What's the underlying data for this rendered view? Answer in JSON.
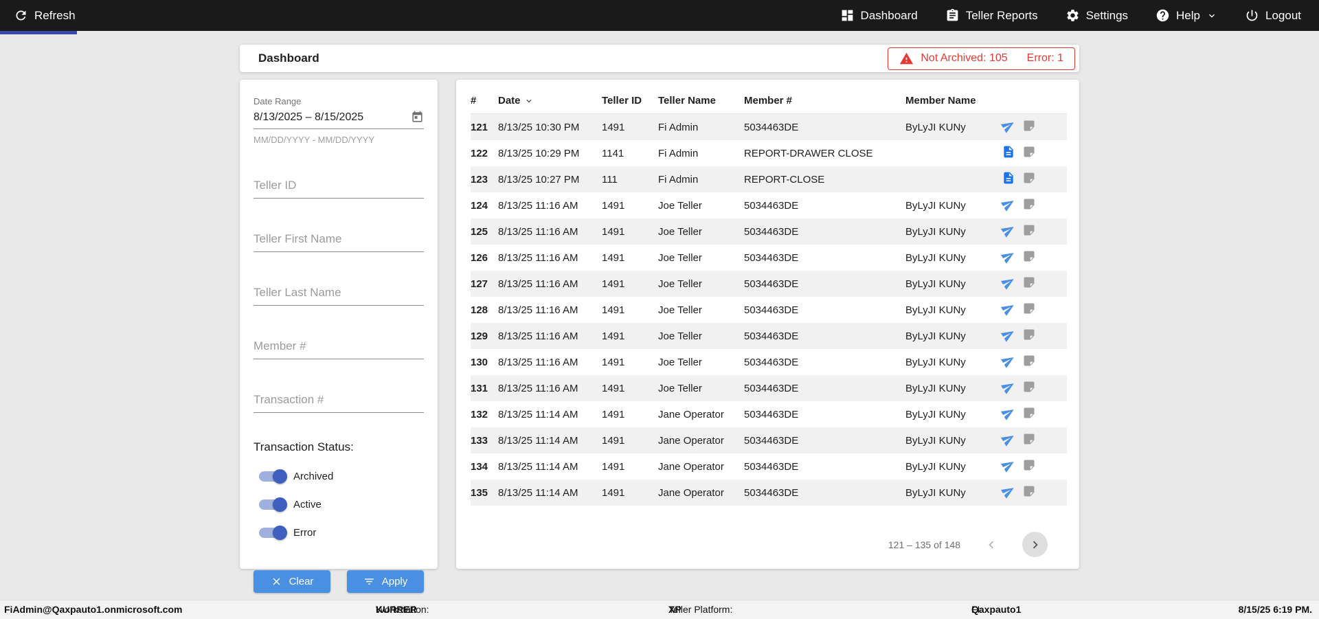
{
  "colors": {
    "accent_blue": "#4a90e2",
    "toggle_blue": "#3f5fbf",
    "doc_blue": "#1a73e8",
    "alert_red": "#e53935"
  },
  "topbar": {
    "refresh_label": "Refresh",
    "nav": [
      {
        "label": "Dashboard"
      },
      {
        "label": "Teller Reports"
      },
      {
        "label": "Settings"
      },
      {
        "label": "Help"
      },
      {
        "label": "Logout"
      }
    ]
  },
  "header": {
    "title": "Dashboard",
    "alert": {
      "not_archived": "Not Archived: 105",
      "error": "Error: 1"
    }
  },
  "filters": {
    "date_range": {
      "label": "Date Range",
      "value": "8/13/2025 – 8/15/2025",
      "hint": "MM/DD/YYYY - MM/DD/YYYY"
    },
    "teller_id_placeholder": "Teller ID",
    "teller_first_placeholder": "Teller First Name",
    "teller_last_placeholder": "Teller Last Name",
    "member_placeholder": "Member #",
    "transaction_placeholder": "Transaction #",
    "status_label": "Transaction Status:",
    "toggles": [
      {
        "label": "Archived",
        "on": true
      },
      {
        "label": "Active",
        "on": true
      },
      {
        "label": "Error",
        "on": true
      }
    ],
    "clear_label": "Clear",
    "apply_label": "Apply"
  },
  "table": {
    "columns": [
      "#",
      "Date",
      "Teller ID",
      "Teller Name",
      "Member #",
      "Member Name"
    ],
    "rows": [
      {
        "num": "121",
        "date": "8/13/25 10:30 PM",
        "teller_id": "1491",
        "teller_name": "Fi Admin",
        "member": "5034463DE",
        "member_name": "ByLyJI KUNy",
        "icon": "send"
      },
      {
        "num": "122",
        "date": "8/13/25 10:29 PM",
        "teller_id": "1141",
        "teller_name": "Fi Admin",
        "member": "REPORT-DRAWER CLOSE",
        "member_name": "",
        "icon": "document"
      },
      {
        "num": "123",
        "date": "8/13/25 10:27 PM",
        "teller_id": "111",
        "teller_name": "Fi Admin",
        "member": "REPORT-CLOSE",
        "member_name": "",
        "icon": "document"
      },
      {
        "num": "124",
        "date": "8/13/25 11:16 AM",
        "teller_id": "1491",
        "teller_name": "Joe Teller",
        "member": "5034463DE",
        "member_name": "ByLyJI KUNy",
        "icon": "send"
      },
      {
        "num": "125",
        "date": "8/13/25 11:16 AM",
        "teller_id": "1491",
        "teller_name": "Joe Teller",
        "member": "5034463DE",
        "member_name": "ByLyJI KUNy",
        "icon": "send"
      },
      {
        "num": "126",
        "date": "8/13/25 11:16 AM",
        "teller_id": "1491",
        "teller_name": "Joe Teller",
        "member": "5034463DE",
        "member_name": "ByLyJI KUNy",
        "icon": "send"
      },
      {
        "num": "127",
        "date": "8/13/25 11:16 AM",
        "teller_id": "1491",
        "teller_name": "Joe Teller",
        "member": "5034463DE",
        "member_name": "ByLyJI KUNy",
        "icon": "send"
      },
      {
        "num": "128",
        "date": "8/13/25 11:16 AM",
        "teller_id": "1491",
        "teller_name": "Joe Teller",
        "member": "5034463DE",
        "member_name": "ByLyJI KUNy",
        "icon": "send"
      },
      {
        "num": "129",
        "date": "8/13/25 11:16 AM",
        "teller_id": "1491",
        "teller_name": "Joe Teller",
        "member": "5034463DE",
        "member_name": "ByLyJI KUNy",
        "icon": "send"
      },
      {
        "num": "130",
        "date": "8/13/25 11:16 AM",
        "teller_id": "1491",
        "teller_name": "Joe Teller",
        "member": "5034463DE",
        "member_name": "ByLyJI KUNy",
        "icon": "send"
      },
      {
        "num": "131",
        "date": "8/13/25 11:16 AM",
        "teller_id": "1491",
        "teller_name": "Joe Teller",
        "member": "5034463DE",
        "member_name": "ByLyJI KUNy",
        "icon": "send"
      },
      {
        "num": "132",
        "date": "8/13/25 11:14 AM",
        "teller_id": "1491",
        "teller_name": "Jane Operator",
        "member": "5034463DE",
        "member_name": "ByLyJI KUNy",
        "icon": "send"
      },
      {
        "num": "133",
        "date": "8/13/25 11:14 AM",
        "teller_id": "1491",
        "teller_name": "Jane Operator",
        "member": "5034463DE",
        "member_name": "ByLyJI KUNy",
        "icon": "send"
      },
      {
        "num": "134",
        "date": "8/13/25 11:14 AM",
        "teller_id": "1491",
        "teller_name": "Jane Operator",
        "member": "5034463DE",
        "member_name": "ByLyJI KUNy",
        "icon": "send"
      },
      {
        "num": "135",
        "date": "8/13/25 11:14 AM",
        "teller_id": "1491",
        "teller_name": "Jane Operator",
        "member": "5034463DE",
        "member_name": "ByLyJI KUNy",
        "icon": "send"
      }
    ],
    "pagination": {
      "range": "121 – 135 of 148"
    }
  },
  "footer": {
    "user": "FiAdmin@Qaxpauto1.onmicrosoft.com",
    "workstation_label": "Workstation:",
    "workstation": "KURRER",
    "platform_label": "Teller Platform:",
    "platform": "XP",
    "fi_label": "FI:",
    "fi": "Qaxpauto1",
    "datetime": "8/15/25 6:19 PM."
  }
}
